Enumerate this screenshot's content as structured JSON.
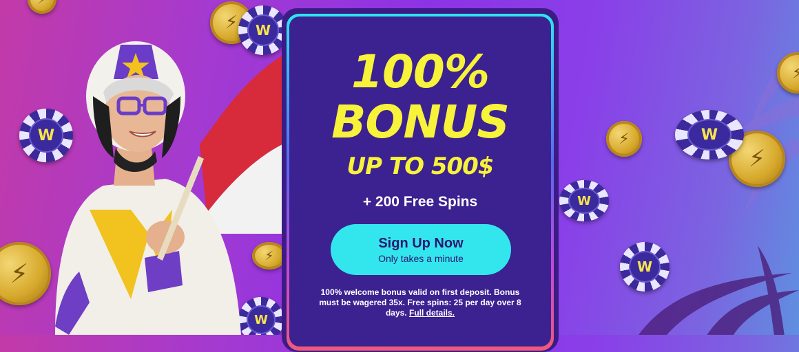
{
  "offer": {
    "headline_line1": "100%",
    "headline_line2": "BONUS",
    "headline_line3": "UP TO 500$",
    "free_spins": "+ 200 Free Spins"
  },
  "cta": {
    "label": "Sign Up Now",
    "sublabel": "Only takes a minute"
  },
  "terms": {
    "text": "100% welcome bonus valid on first deposit. Bonus must be wagered 35x. Free spins: 25 per day over 8 days.",
    "link_label": "Full details."
  },
  "decor": {
    "chip_glyph": "W",
    "coin_glyph": "⚡",
    "icons": [
      "coin-icon",
      "poker-chip-icon",
      "palm-leaf-icon",
      "flag-icon",
      "rider-illustration"
    ]
  },
  "colors": {
    "panel": "#3c2190",
    "headline": "#f7f23a",
    "cta": "#33e6ee",
    "cta_text": "#2a1670"
  }
}
